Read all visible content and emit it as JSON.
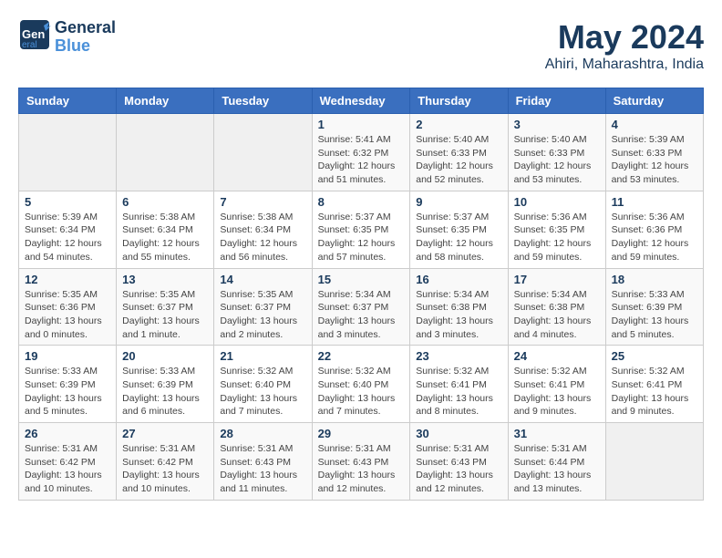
{
  "header": {
    "logo_general": "General",
    "logo_blue": "Blue",
    "title": "May 2024",
    "subtitle": "Ahiri, Maharashtra, India"
  },
  "weekdays": [
    "Sunday",
    "Monday",
    "Tuesday",
    "Wednesday",
    "Thursday",
    "Friday",
    "Saturday"
  ],
  "weeks": [
    [
      {
        "day": "",
        "sunrise": "",
        "sunset": "",
        "daylight": ""
      },
      {
        "day": "",
        "sunrise": "",
        "sunset": "",
        "daylight": ""
      },
      {
        "day": "",
        "sunrise": "",
        "sunset": "",
        "daylight": ""
      },
      {
        "day": "1",
        "sunrise": "Sunrise: 5:41 AM",
        "sunset": "Sunset: 6:32 PM",
        "daylight": "Daylight: 12 hours and 51 minutes."
      },
      {
        "day": "2",
        "sunrise": "Sunrise: 5:40 AM",
        "sunset": "Sunset: 6:33 PM",
        "daylight": "Daylight: 12 hours and 52 minutes."
      },
      {
        "day": "3",
        "sunrise": "Sunrise: 5:40 AM",
        "sunset": "Sunset: 6:33 PM",
        "daylight": "Daylight: 12 hours and 53 minutes."
      },
      {
        "day": "4",
        "sunrise": "Sunrise: 5:39 AM",
        "sunset": "Sunset: 6:33 PM",
        "daylight": "Daylight: 12 hours and 53 minutes."
      }
    ],
    [
      {
        "day": "5",
        "sunrise": "Sunrise: 5:39 AM",
        "sunset": "Sunset: 6:34 PM",
        "daylight": "Daylight: 12 hours and 54 minutes."
      },
      {
        "day": "6",
        "sunrise": "Sunrise: 5:38 AM",
        "sunset": "Sunset: 6:34 PM",
        "daylight": "Daylight: 12 hours and 55 minutes."
      },
      {
        "day": "7",
        "sunrise": "Sunrise: 5:38 AM",
        "sunset": "Sunset: 6:34 PM",
        "daylight": "Daylight: 12 hours and 56 minutes."
      },
      {
        "day": "8",
        "sunrise": "Sunrise: 5:37 AM",
        "sunset": "Sunset: 6:35 PM",
        "daylight": "Daylight: 12 hours and 57 minutes."
      },
      {
        "day": "9",
        "sunrise": "Sunrise: 5:37 AM",
        "sunset": "Sunset: 6:35 PM",
        "daylight": "Daylight: 12 hours and 58 minutes."
      },
      {
        "day": "10",
        "sunrise": "Sunrise: 5:36 AM",
        "sunset": "Sunset: 6:35 PM",
        "daylight": "Daylight: 12 hours and 59 minutes."
      },
      {
        "day": "11",
        "sunrise": "Sunrise: 5:36 AM",
        "sunset": "Sunset: 6:36 PM",
        "daylight": "Daylight: 12 hours and 59 minutes."
      }
    ],
    [
      {
        "day": "12",
        "sunrise": "Sunrise: 5:35 AM",
        "sunset": "Sunset: 6:36 PM",
        "daylight": "Daylight: 13 hours and 0 minutes."
      },
      {
        "day": "13",
        "sunrise": "Sunrise: 5:35 AM",
        "sunset": "Sunset: 6:37 PM",
        "daylight": "Daylight: 13 hours and 1 minute."
      },
      {
        "day": "14",
        "sunrise": "Sunrise: 5:35 AM",
        "sunset": "Sunset: 6:37 PM",
        "daylight": "Daylight: 13 hours and 2 minutes."
      },
      {
        "day": "15",
        "sunrise": "Sunrise: 5:34 AM",
        "sunset": "Sunset: 6:37 PM",
        "daylight": "Daylight: 13 hours and 3 minutes."
      },
      {
        "day": "16",
        "sunrise": "Sunrise: 5:34 AM",
        "sunset": "Sunset: 6:38 PM",
        "daylight": "Daylight: 13 hours and 3 minutes."
      },
      {
        "day": "17",
        "sunrise": "Sunrise: 5:34 AM",
        "sunset": "Sunset: 6:38 PM",
        "daylight": "Daylight: 13 hours and 4 minutes."
      },
      {
        "day": "18",
        "sunrise": "Sunrise: 5:33 AM",
        "sunset": "Sunset: 6:39 PM",
        "daylight": "Daylight: 13 hours and 5 minutes."
      }
    ],
    [
      {
        "day": "19",
        "sunrise": "Sunrise: 5:33 AM",
        "sunset": "Sunset: 6:39 PM",
        "daylight": "Daylight: 13 hours and 5 minutes."
      },
      {
        "day": "20",
        "sunrise": "Sunrise: 5:33 AM",
        "sunset": "Sunset: 6:39 PM",
        "daylight": "Daylight: 13 hours and 6 minutes."
      },
      {
        "day": "21",
        "sunrise": "Sunrise: 5:32 AM",
        "sunset": "Sunset: 6:40 PM",
        "daylight": "Daylight: 13 hours and 7 minutes."
      },
      {
        "day": "22",
        "sunrise": "Sunrise: 5:32 AM",
        "sunset": "Sunset: 6:40 PM",
        "daylight": "Daylight: 13 hours and 7 minutes."
      },
      {
        "day": "23",
        "sunrise": "Sunrise: 5:32 AM",
        "sunset": "Sunset: 6:41 PM",
        "daylight": "Daylight: 13 hours and 8 minutes."
      },
      {
        "day": "24",
        "sunrise": "Sunrise: 5:32 AM",
        "sunset": "Sunset: 6:41 PM",
        "daylight": "Daylight: 13 hours and 9 minutes."
      },
      {
        "day": "25",
        "sunrise": "Sunrise: 5:32 AM",
        "sunset": "Sunset: 6:41 PM",
        "daylight": "Daylight: 13 hours and 9 minutes."
      }
    ],
    [
      {
        "day": "26",
        "sunrise": "Sunrise: 5:31 AM",
        "sunset": "Sunset: 6:42 PM",
        "daylight": "Daylight: 13 hours and 10 minutes."
      },
      {
        "day": "27",
        "sunrise": "Sunrise: 5:31 AM",
        "sunset": "Sunset: 6:42 PM",
        "daylight": "Daylight: 13 hours and 10 minutes."
      },
      {
        "day": "28",
        "sunrise": "Sunrise: 5:31 AM",
        "sunset": "Sunset: 6:43 PM",
        "daylight": "Daylight: 13 hours and 11 minutes."
      },
      {
        "day": "29",
        "sunrise": "Sunrise: 5:31 AM",
        "sunset": "Sunset: 6:43 PM",
        "daylight": "Daylight: 13 hours and 12 minutes."
      },
      {
        "day": "30",
        "sunrise": "Sunrise: 5:31 AM",
        "sunset": "Sunset: 6:43 PM",
        "daylight": "Daylight: 13 hours and 12 minutes."
      },
      {
        "day": "31",
        "sunrise": "Sunrise: 5:31 AM",
        "sunset": "Sunset: 6:44 PM",
        "daylight": "Daylight: 13 hours and 13 minutes."
      },
      {
        "day": "",
        "sunrise": "",
        "sunset": "",
        "daylight": ""
      }
    ]
  ]
}
